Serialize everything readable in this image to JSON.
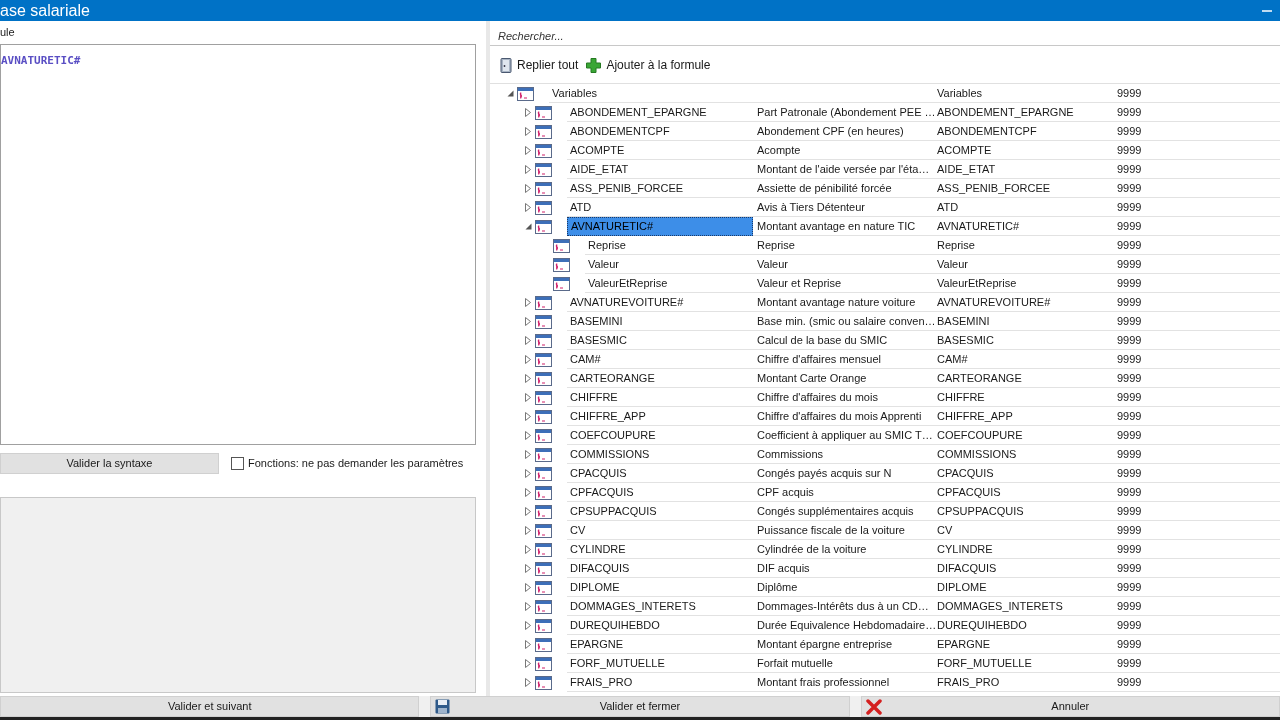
{
  "window": {
    "title": "ase salariale"
  },
  "editor": {
    "label": "ule",
    "value": "AVNATURETIC#"
  },
  "validate_button": "Valider la syntaxe",
  "option": {
    "label": "Fonctions: ne pas demander les paramètres",
    "checked": false
  },
  "search": {
    "placeholder": "Rechercher..."
  },
  "toolbar": [
    {
      "kind": "collapse",
      "label": "Replier tout"
    },
    {
      "kind": "add",
      "label": "Ajouter à la formule"
    }
  ],
  "tree": [
    {
      "name": "Variables",
      "variable": "Variables",
      "code": "9999",
      "expanded": true,
      "selected": false,
      "children": [
        {
          "name": "ABONDEMENT_EPARGNE",
          "description": "Part Patronale (Abondement PEE …",
          "variable": "ABONDEMENT_EPARGNE",
          "code": "9999",
          "expanded": false,
          "selected": false
        },
        {
          "name": "ABONDEMENTCPF",
          "description": "Abondement CPF (en heures)",
          "variable": "ABONDEMENTCPF",
          "code": "9999",
          "expanded": false,
          "selected": false
        },
        {
          "name": "ACOMPTE",
          "description": "Acompte",
          "variable": "ACOMPTE",
          "code": "9999",
          "expanded": false,
          "selected": false
        },
        {
          "name": "AIDE_ETAT",
          "description": "Montant de l'aide versée par l'éta…",
          "variable": "AIDE_ETAT",
          "code": "9999",
          "expanded": false,
          "selected": false
        },
        {
          "name": "ASS_PENIB_FORCEE",
          "description": "Assiette de pénibilité forcée",
          "variable": "ASS_PENIB_FORCEE",
          "code": "9999",
          "expanded": false,
          "selected": false
        },
        {
          "name": "ATD",
          "description": "Avis à Tiers Détenteur",
          "variable": "ATD",
          "code": "9999",
          "expanded": false,
          "selected": false
        },
        {
          "name": "AVNATURETIC#",
          "description": "Montant avantage en nature TIC",
          "variable": "AVNATURETIC#",
          "code": "9999",
          "expanded": true,
          "selected": true,
          "children": [
            {
              "name": "Reprise",
              "description": "Reprise",
              "variable": "Reprise",
              "code": "9999",
              "selected": false
            },
            {
              "name": "Valeur",
              "description": "Valeur",
              "variable": "Valeur",
              "code": "9999",
              "selected": false
            },
            {
              "name": "ValeurEtReprise",
              "description": "Valeur et Reprise",
              "variable": "ValeurEtReprise",
              "code": "9999",
              "selected": false
            }
          ]
        },
        {
          "name": "AVNATUREVOITURE#",
          "description": "Montant avantage nature voiture",
          "variable": "AVNATUREVOITURE#",
          "code": "9999",
          "expanded": false,
          "selected": false
        },
        {
          "name": "BASEMINI",
          "description": "Base min. (smic ou salaire conven…",
          "variable": "BASEMINI",
          "code": "9999",
          "expanded": false,
          "selected": false
        },
        {
          "name": "BASESMIC",
          "description": "Calcul de la base du SMIC",
          "variable": "BASESMIC",
          "code": "9999",
          "expanded": false,
          "selected": false
        },
        {
          "name": "CAM#",
          "description": "Chiffre d'affaires mensuel",
          "variable": "CAM#",
          "code": "9999",
          "expanded": false,
          "selected": false
        },
        {
          "name": "CARTEORANGE",
          "description": "Montant Carte Orange",
          "variable": "CARTEORANGE",
          "code": "9999",
          "expanded": false,
          "selected": false
        },
        {
          "name": "CHIFFRE",
          "description": "Chiffre d'affaires du mois",
          "variable": "CHIFFRE",
          "code": "9999",
          "expanded": false,
          "selected": false
        },
        {
          "name": "CHIFFRE_APP",
          "description": "Chiffre d'affaires du mois Apprenti",
          "variable": "CHIFFRE_APP",
          "code": "9999",
          "expanded": false,
          "selected": false
        },
        {
          "name": "COEFCOUPURE",
          "description": "Coefficient à appliquer au SMIC T…",
          "variable": "COEFCOUPURE",
          "code": "9999",
          "expanded": false,
          "selected": false
        },
        {
          "name": "COMMISSIONS",
          "description": "Commissions",
          "variable": "COMMISSIONS",
          "code": "9999",
          "expanded": false,
          "selected": false
        },
        {
          "name": "CPACQUIS",
          "description": "Congés payés acquis sur N",
          "variable": "CPACQUIS",
          "code": "9999",
          "expanded": false,
          "selected": false
        },
        {
          "name": "CPFACQUIS",
          "description": "CPF acquis",
          "variable": "CPFACQUIS",
          "code": "9999",
          "expanded": false,
          "selected": false
        },
        {
          "name": "CPSUPPACQUIS",
          "description": "Congés supplémentaires acquis",
          "variable": "CPSUPPACQUIS",
          "code": "9999",
          "expanded": false,
          "selected": false
        },
        {
          "name": "CV",
          "description": "Puissance fiscale de la voiture",
          "variable": "CV",
          "code": "9999",
          "expanded": false,
          "selected": false
        },
        {
          "name": "CYLINDRE",
          "description": "Cylindrée de la voiture",
          "variable": "CYLINDRE",
          "code": "9999",
          "expanded": false,
          "selected": false
        },
        {
          "name": "DIFACQUIS",
          "description": "DIF acquis",
          "variable": "DIFACQUIS",
          "code": "9999",
          "expanded": false,
          "selected": false
        },
        {
          "name": "DIPLOME",
          "description": "Diplôme",
          "variable": "DIPLOME",
          "code": "9999",
          "expanded": false,
          "selected": false
        },
        {
          "name": "DOMMAGES_INTERETS",
          "description": "Dommages-Intérêts dus à un CD…",
          "variable": "DOMMAGES_INTERETS",
          "code": "9999",
          "expanded": false,
          "selected": false
        },
        {
          "name": "DUREQUIHEBDO",
          "description": "Durée Equivalence Hebdomadaire…",
          "variable": "DUREQUIHEBDO",
          "code": "9999",
          "expanded": false,
          "selected": false
        },
        {
          "name": "EPARGNE",
          "description": "Montant épargne entreprise",
          "variable": "EPARGNE",
          "code": "9999",
          "expanded": false,
          "selected": false
        },
        {
          "name": "FORF_MUTUELLE",
          "description": "Forfait mutuelle",
          "variable": "FORF_MUTUELLE",
          "code": "9999",
          "expanded": false,
          "selected": false
        },
        {
          "name": "FRAIS_PRO",
          "description": "Montant frais professionnel",
          "variable": "FRAIS_PRO",
          "code": "9999",
          "expanded": false,
          "selected": false
        }
      ]
    }
  ],
  "footer_buttons": [
    {
      "kind": "next",
      "label": "Valider et suivant"
    },
    {
      "kind": "save",
      "label": "Valider et fermer"
    },
    {
      "kind": "cancel",
      "label": "Annuler"
    }
  ]
}
